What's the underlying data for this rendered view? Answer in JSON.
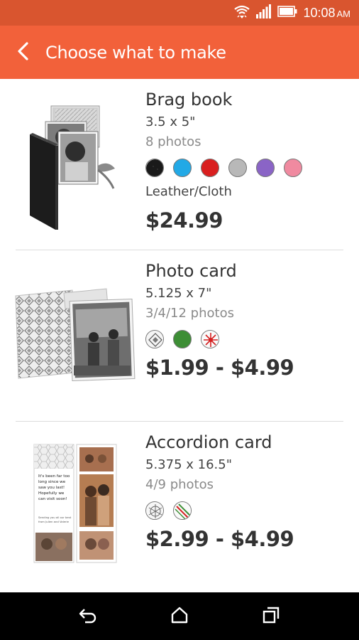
{
  "status_bar": {
    "time": "10:08",
    "ampm": "AM",
    "icons": [
      "wifi-icon",
      "signal-icon",
      "battery-icon"
    ]
  },
  "app_bar": {
    "title": "Choose what to make",
    "back_icon": "back-arrow-icon",
    "background": "#f2613a"
  },
  "products": [
    {
      "name": "Brag book",
      "size": "3.5 x 5\"",
      "photos": "8 photos",
      "swatches": [
        "black",
        "sky-blue",
        "red",
        "gray",
        "purple",
        "pink"
      ],
      "material": "Leather/Cloth",
      "price": "$24.99"
    },
    {
      "name": "Photo card",
      "size": "5.125 x 7\"",
      "photos": "3/4/12 photos",
      "swatches": [
        "diamond-pattern",
        "green",
        "red-starburst"
      ],
      "price": "$1.99 - $4.99"
    },
    {
      "name": "Accordion card",
      "size": "5.375 x 16.5\"",
      "photos": "4/9 photos",
      "swatches": [
        "hexagon-pattern",
        "red-green-stripes"
      ],
      "price": "$2.99 - $4.99",
      "thumb_text": "It's been far too long since we saw you last! Hopefully we can visit soon!",
      "thumb_signature": "Sending you all our best from Julien and Valerie"
    }
  ],
  "nav_bar": {
    "icons": [
      "back-nav-icon",
      "home-icon",
      "recent-apps-icon"
    ]
  }
}
